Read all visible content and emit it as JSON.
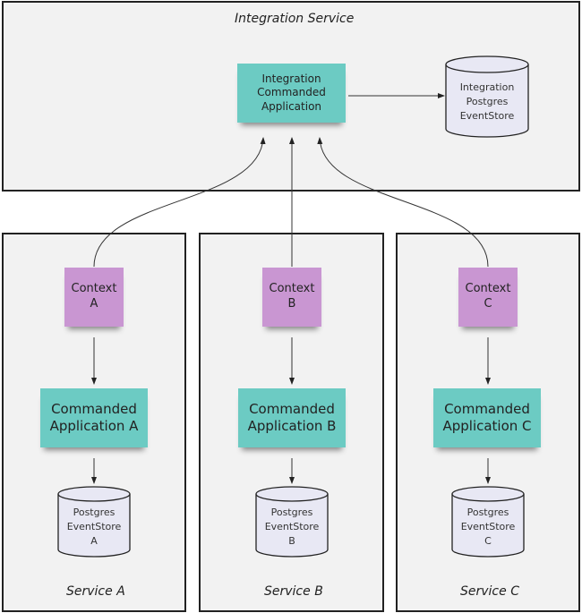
{
  "integration_service": {
    "title": "Integration Service",
    "app_lines": [
      "Integration",
      "Commanded",
      "Application"
    ],
    "store_lines": [
      "Integration",
      "Postgres",
      "EventStore"
    ]
  },
  "services": [
    {
      "title": "Service A",
      "context_lines": [
        "Context",
        "A"
      ],
      "app_lines": [
        "Commanded",
        "Application A"
      ],
      "store_lines": [
        "Postgres",
        "EventStore",
        "A"
      ]
    },
    {
      "title": "Service B",
      "context_lines": [
        "Context",
        "B"
      ],
      "app_lines": [
        "Commanded",
        "Application B"
      ],
      "store_lines": [
        "Postgres",
        "EventStore",
        "B"
      ]
    },
    {
      "title": "Service C",
      "context_lines": [
        "Context",
        "C"
      ],
      "app_lines": [
        "Commanded",
        "Application C"
      ],
      "store_lines": [
        "Postgres",
        "EventStore",
        "C"
      ]
    }
  ],
  "colors": {
    "application": "#6ccbc3",
    "context": "#c996d2",
    "eventstore": "#e8e8f4",
    "frame": "#f2f2f2"
  }
}
